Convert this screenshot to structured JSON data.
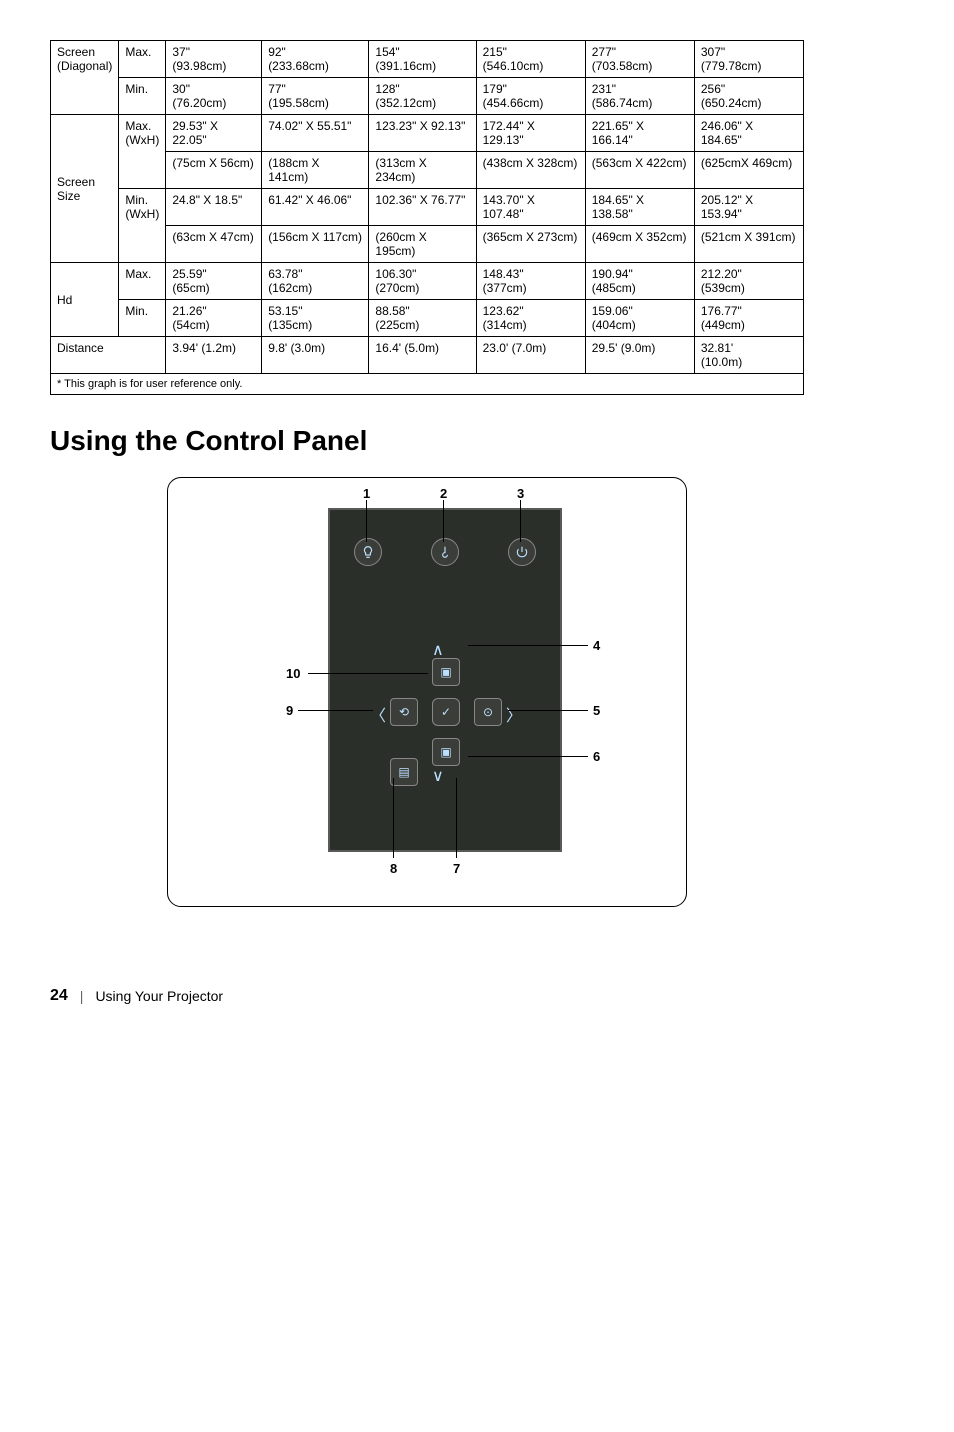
{
  "table": {
    "screen_diag": {
      "label": "Screen\n(Diagonal)",
      "max_label": "Max.",
      "min_label": "Min.",
      "max": [
        "37\"\n(93.98cm)",
        "92\"\n(233.68cm)",
        "154\"\n(391.16cm)",
        "215\"\n(546.10cm)",
        "277\"\n(703.58cm)",
        "307\"\n(779.78cm)"
      ],
      "min": [
        "30\"\n(76.20cm)",
        "77\"\n(195.58cm)",
        "128\"\n(352.12cm)",
        "179\"\n(454.66cm)",
        "231\"\n(586.74cm)",
        "256\"\n(650.24cm)"
      ]
    },
    "screen_size": {
      "label": "Screen\nSize",
      "max_label": "Max.\n(WxH)",
      "min_label": "Min.\n(WxH)",
      "max_a": [
        "29.53\" X 22.05\"",
        "74.02\" X 55.51\"",
        "123.23\" X 92.13\"",
        "172.44\" X 129.13\"",
        "221.65\" X 166.14\"",
        "246.06\" X 184.65\""
      ],
      "max_b": [
        "(75cm X 56cm)",
        "(188cm X 141cm)",
        "(313cm X 234cm)",
        "(438cm X 328cm)",
        "(563cm X 422cm)",
        "(625cmX 469cm)"
      ],
      "min_a": [
        "24.8\" X 18.5\"",
        "61.42\" X 46.06\"",
        "102.36\" X 76.77\"",
        "143.70\" X 107.48\"",
        "184.65\" X 138.58\"",
        "205.12\" X 153.94\""
      ],
      "min_b": [
        "(63cm X 47cm)",
        "(156cm X 117cm)",
        "(260cm X 195cm)",
        "(365cm X 273cm)",
        "(469cm X 352cm)",
        "(521cm X 391cm)"
      ]
    },
    "hd": {
      "label": "Hd",
      "max_label": "Max.",
      "min_label": "Min.",
      "max": [
        "25.59\"\n(65cm)",
        "63.78\"\n(162cm)",
        "106.30\"\n(270cm)",
        "148.43\"\n(377cm)",
        "190.94\"\n(485cm)",
        "212.20\"\n(539cm)"
      ],
      "min": [
        "21.26\"\n(54cm)",
        "53.15\"\n(135cm)",
        "88.58\"\n(225cm)",
        "123.62\"\n(314cm)",
        "159.06\"\n(404cm)",
        "176.77\"\n(449cm)"
      ]
    },
    "distance": {
      "label": "Distance",
      "vals": [
        "3.94' (1.2m)",
        "9.8' (3.0m)",
        "16.4' (5.0m)",
        "23.0' (7.0m)",
        "29.5' (9.0m)",
        "32.81'\n(10.0m)"
      ]
    },
    "footnote": "* This graph is for user reference only."
  },
  "heading": "Using the Control Panel",
  "callouts": [
    "1",
    "2",
    "3",
    "4",
    "5",
    "6",
    "7",
    "8",
    "9",
    "10"
  ],
  "footer": {
    "page": "24",
    "section": "Using Your Projector"
  }
}
